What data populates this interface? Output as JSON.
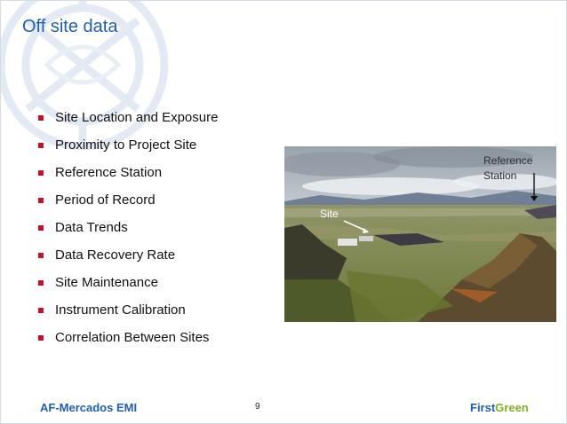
{
  "slide": {
    "title": "Off site data",
    "bullets": [
      "Site Location and Exposure",
      "Proximity to Project Site",
      "Reference Station",
      "Period of Record",
      "Data Trends",
      "Data Recovery Rate",
      "Site Maintenance",
      "Instrument Calibration",
      "Correlation Between Sites"
    ],
    "photo": {
      "label_site": "Site",
      "label_reference_line1": "Reference",
      "label_reference_line2": "Station"
    },
    "footer": {
      "left": "AF-Mercados EMI",
      "page_number": "9",
      "right_first": "First",
      "right_green": "Green"
    }
  },
  "colors": {
    "title": "#1f5fb0",
    "bullet": "#c8102e",
    "brand_green": "#7ab51d"
  }
}
